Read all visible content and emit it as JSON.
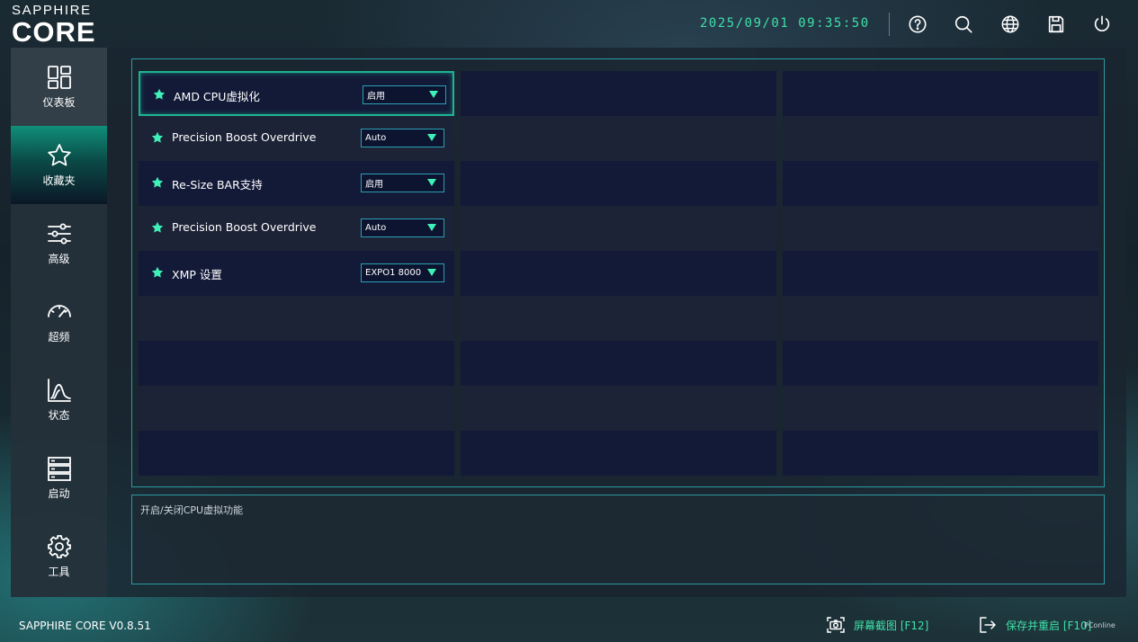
{
  "brand": {
    "line1": "SAPPHIRE",
    "line2": "CORE"
  },
  "header": {
    "datetime": "2025/09/01 09:35:50",
    "icons": [
      "help-icon",
      "search-icon",
      "globe-icon",
      "save-icon",
      "power-icon"
    ]
  },
  "sidebar": {
    "items": [
      {
        "label": "仪表板",
        "icon": "dashboard-icon"
      },
      {
        "label": "收藏夹",
        "icon": "star-icon",
        "active": true
      },
      {
        "label": "高级",
        "icon": "sliders-icon"
      },
      {
        "label": "超频",
        "icon": "gauge-icon"
      },
      {
        "label": "状态",
        "icon": "chart-icon"
      },
      {
        "label": "启动",
        "icon": "server-icon"
      },
      {
        "label": "工具",
        "icon": "gear-icon"
      }
    ]
  },
  "settings": [
    {
      "label": "AMD CPU虚拟化",
      "value": "启用",
      "selected": true
    },
    {
      "label": "Precision Boost Overdrive",
      "value": "Auto"
    },
    {
      "label": "Re-Size BAR支持",
      "value": "启用"
    },
    {
      "label": "Precision Boost Overdrive",
      "value": "Auto"
    },
    {
      "label": "XMP 设置",
      "value": "EXPO1 8000"
    }
  ],
  "description": "开启/关闭CPU虚拟功能",
  "footer": {
    "version": "SAPPHIRE CORE V0.8.51",
    "screenshot_label": "屏幕截图 [F12]",
    "save_restart_label": "保存并重启 [F10]",
    "watermark": "PConline"
  },
  "colors": {
    "accent": "#3fe0a8",
    "border": "#2a9aa0",
    "active_nav": "#0f8f7a"
  }
}
